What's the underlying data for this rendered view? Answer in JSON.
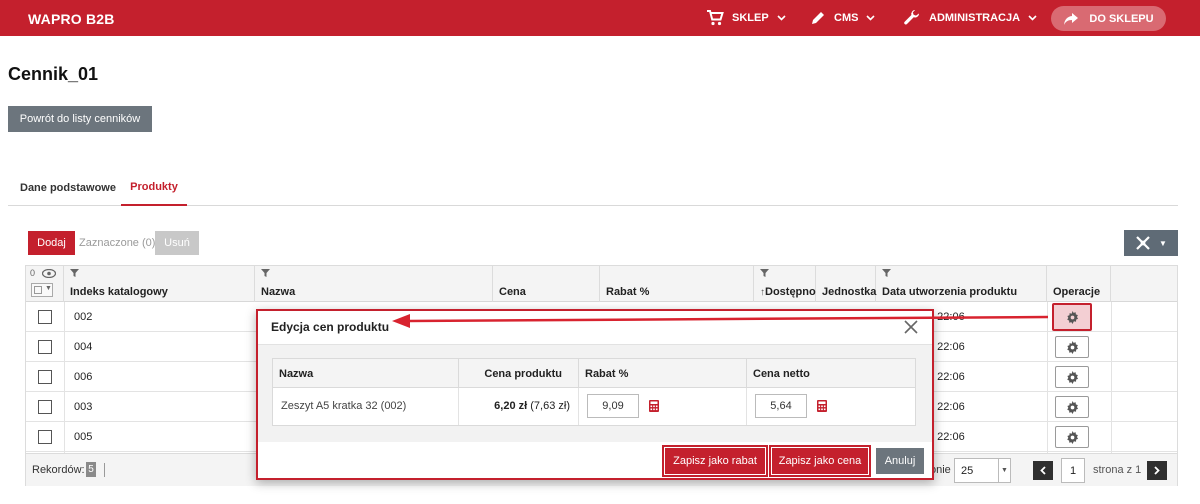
{
  "header": {
    "brand": "WAPRO B2B",
    "nav": [
      {
        "label": "SKLEP",
        "icon": "cart-icon"
      },
      {
        "label": "CMS",
        "icon": "pencil-icon"
      },
      {
        "label": "ADMINISTRACJA",
        "icon": "wrench-icon"
      }
    ],
    "shop_button": "DO SKLEPU"
  },
  "page": {
    "title": "Cennik_01",
    "back_button": "Powrót do listy cenników"
  },
  "tabs": [
    {
      "label": "Dane podstawowe",
      "active": false
    },
    {
      "label": "Produkty",
      "active": true
    }
  ],
  "toolbar": {
    "add": "Dodaj",
    "selected": "Zaznaczone (0)",
    "delete": "Usuń"
  },
  "grid": {
    "visible_count": "0",
    "columns": [
      "Indeks katalogowy",
      "Nazwa",
      "Cena",
      "Rabat %",
      "Dostępno",
      "Jednostka",
      "Data utworzenia produktu",
      "Operacje"
    ],
    "rows": [
      {
        "code": "002",
        "date": "5 22:06"
      },
      {
        "code": "004",
        "date": "5 22:06"
      },
      {
        "code": "006",
        "date": "5 22:06"
      },
      {
        "code": "003",
        "date": "5 22:06"
      },
      {
        "code": "005",
        "date": "5 22:06"
      }
    ],
    "footer": {
      "records_label": "Rekordów:",
      "records_count": "5",
      "per_page_label": "onie",
      "per_page": "25",
      "page": "1",
      "page_of": "strona z 1"
    }
  },
  "modal": {
    "title": "Edycja cen produktu",
    "columns": [
      "Nazwa",
      "Cena produktu",
      "Rabat %",
      "Cena netto"
    ],
    "row": {
      "name": "Zeszyt A5 kratka 32 (002)",
      "price_bold": "6,20 zł",
      "price_gross": "(7,63 zł)",
      "discount": "9,09",
      "net": "5,64"
    },
    "buttons": {
      "save_discount": "Zapisz jako rabat",
      "save_price": "Zapisz jako cena",
      "cancel": "Anuluj"
    }
  },
  "colors": {
    "brand_red": "#c4202d",
    "gray_button": "#6c757d"
  }
}
